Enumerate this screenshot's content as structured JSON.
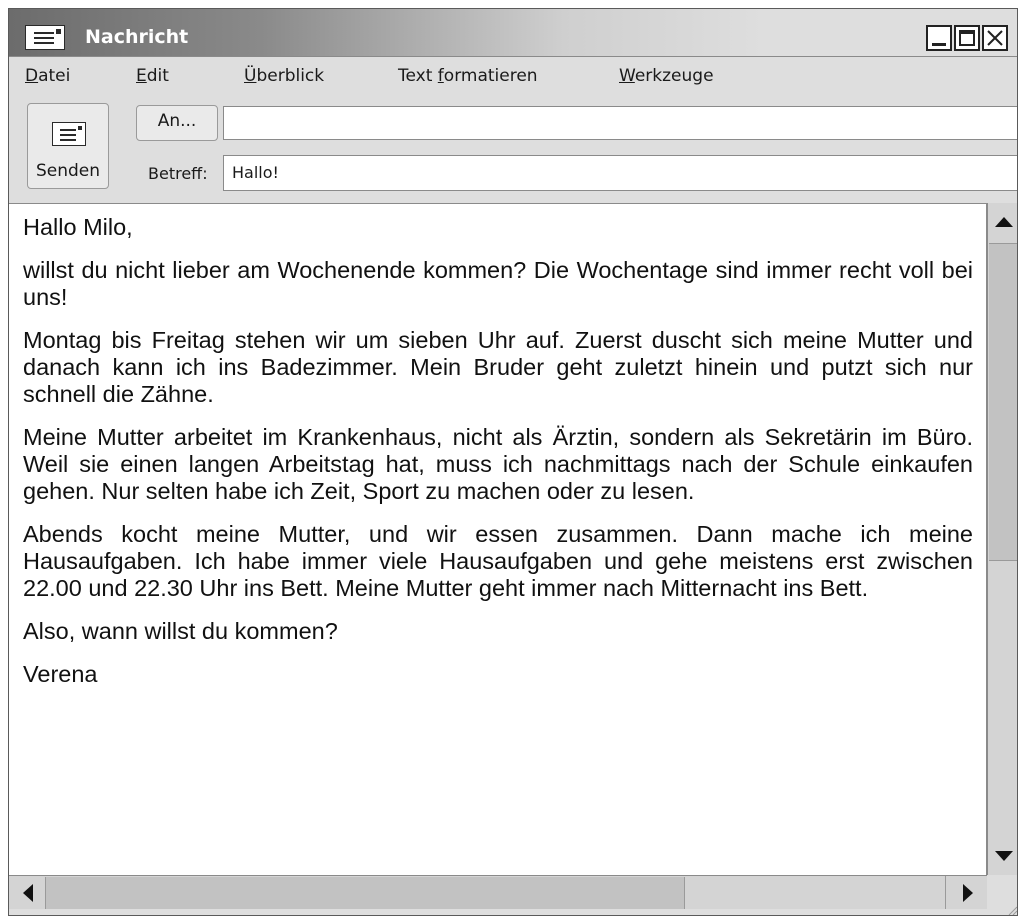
{
  "window": {
    "title": "Nachricht",
    "icon": "envelope-icon"
  },
  "menu": {
    "file": {
      "mnemonic": "D",
      "rest": "atei"
    },
    "edit": {
      "mnemonic": "E",
      "rest": "dit"
    },
    "view": {
      "mnemonic": "Ü",
      "rest": "berblick"
    },
    "format": {
      "pre": "Text ",
      "mnemonic": "f",
      "rest": "ormatieren"
    },
    "tools": {
      "mnemonic": "W",
      "rest": "erkzeuge"
    }
  },
  "toolbar": {
    "send_label": "Senden",
    "to_button": "An...",
    "to_value": "",
    "subject_label": "Betreff:",
    "subject_value": "Hallo!"
  },
  "message": {
    "greeting": "Hallo Milo,",
    "paragraphs": [
      "willst du nicht lieber am Wochenende kommen? Die Wochentage sind immer recht voll bei uns!",
      "Montag bis Freitag stehen wir um sieben Uhr auf. Zuerst duscht sich meine Mutter und danach kann ich ins Badezimmer. Mein Bruder geht zuletzt hinein und putzt sich nur schnell die Zähne.",
      "Meine Mutter arbeitet im Krankenhaus, nicht als Ärztin, sondern als Sekretärin im Büro. Weil sie einen langen Arbeitstag hat, muss ich nachmittags nach der Schule einkaufen gehen. Nur selten habe ich Zeit, Sport zu machen oder zu lesen.",
      "Abends kocht meine Mutter, und wir essen zusammen. Dann mache ich meine Hausaufgaben. Ich habe immer viele Hausaufgaben und gehe meistens erst zwischen 22.00 und 22.30 Uhr ins Bett. Meine Mutter geht immer nach Mitternacht ins Bett."
    ],
    "question": "Also, wann willst du kommen?",
    "signature": "Verena"
  }
}
